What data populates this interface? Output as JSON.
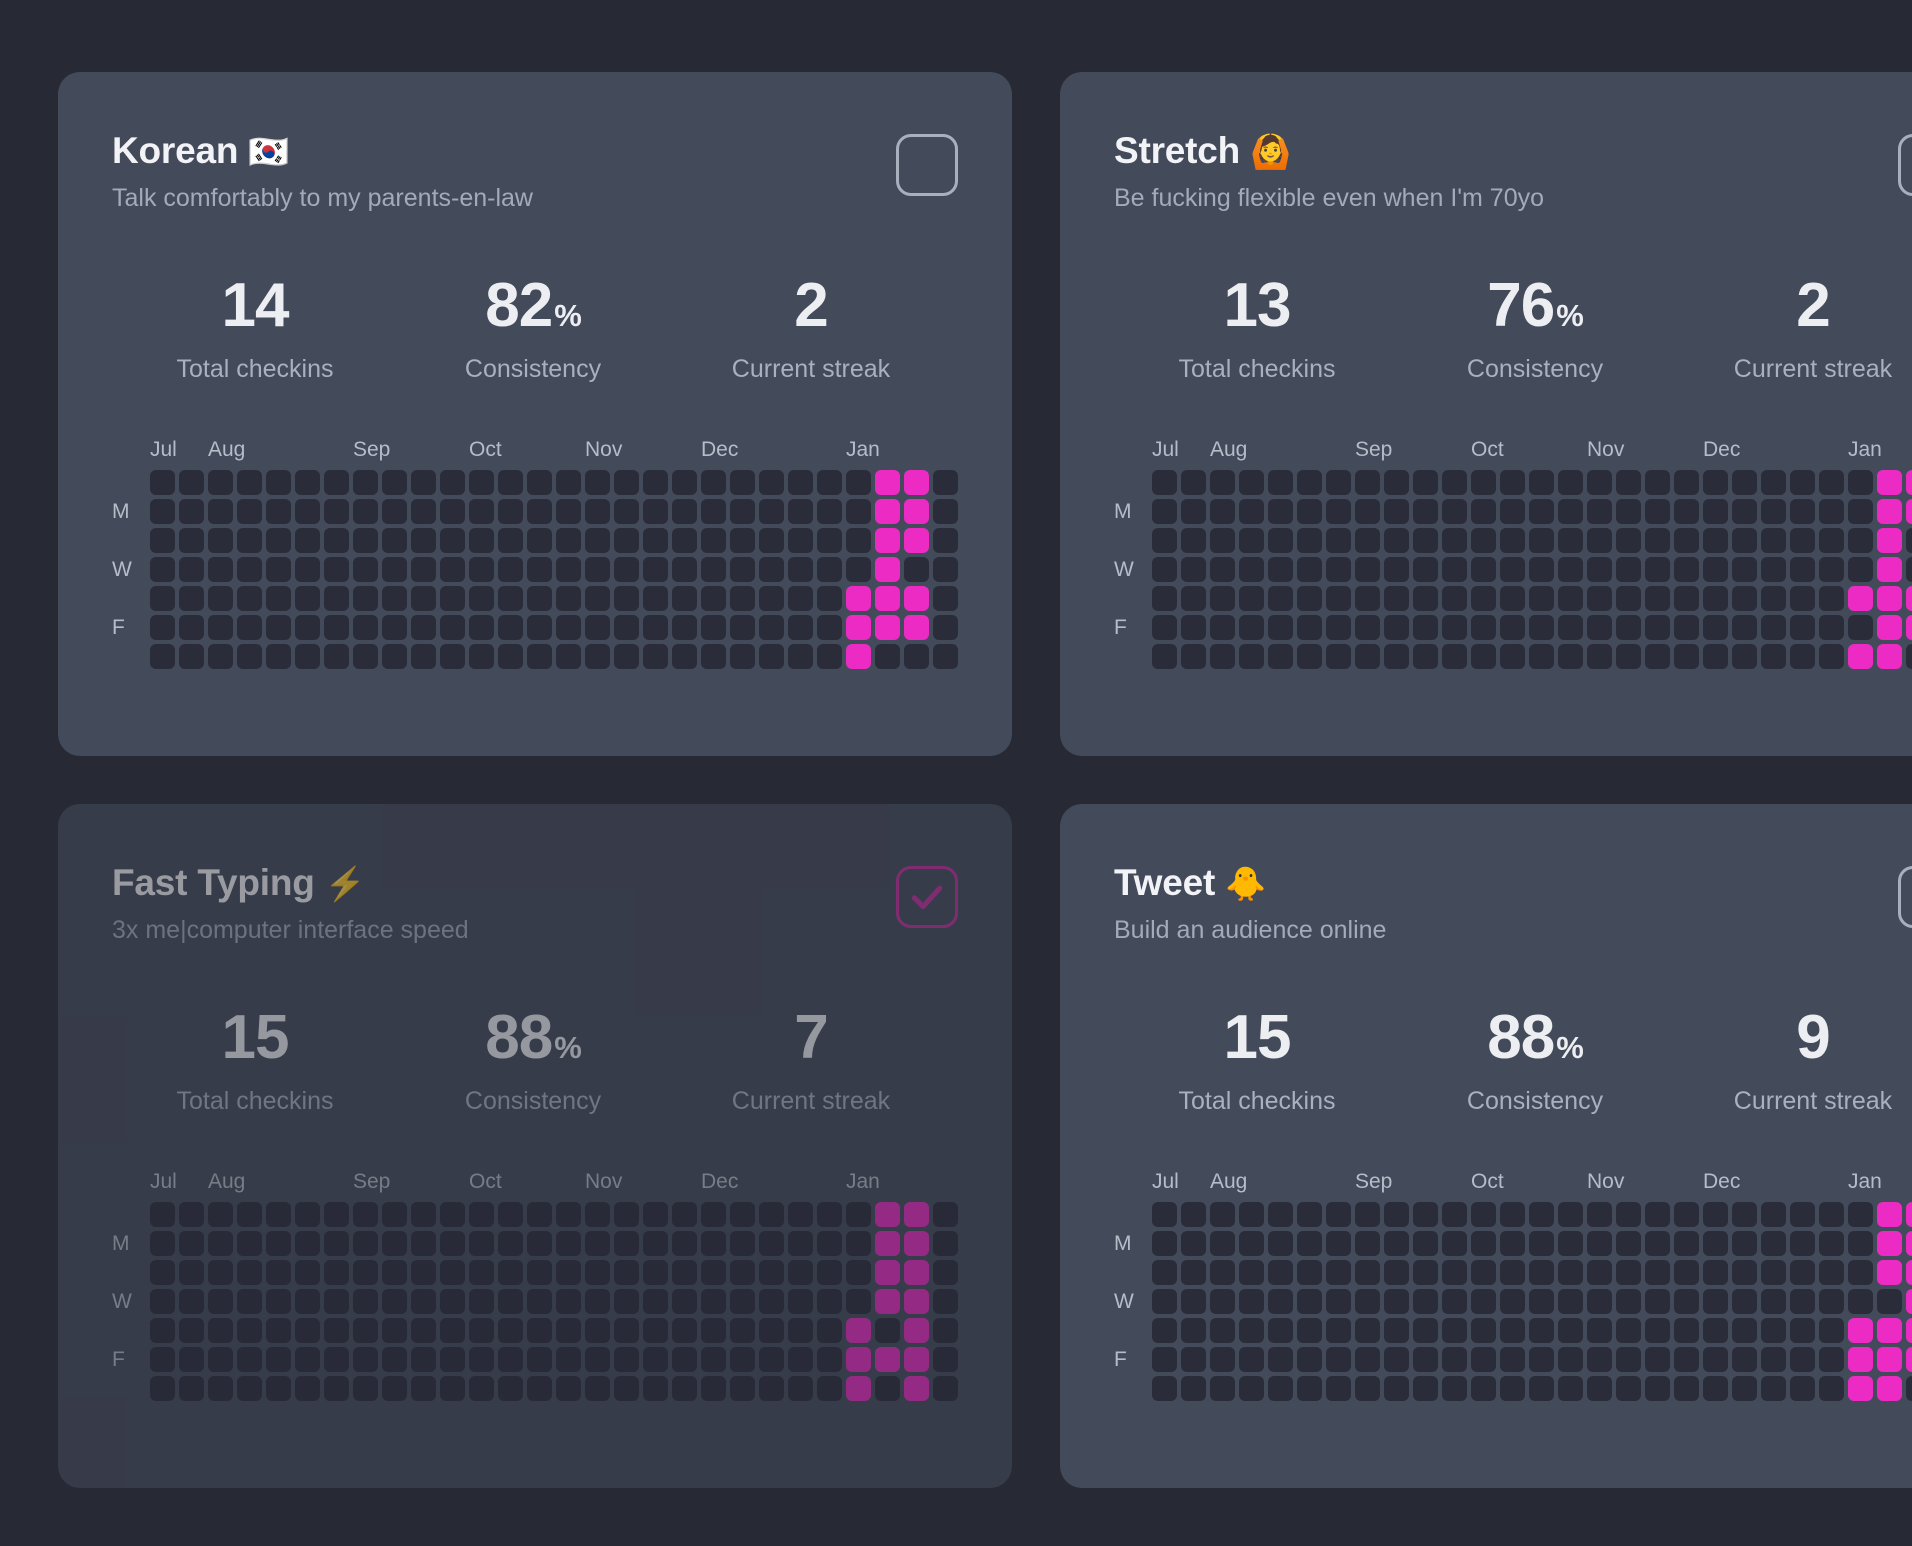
{
  "theme": {
    "background": "#272a35",
    "card_background": "#434a5a",
    "accent": "#ec2bc4",
    "cell_empty": "#2a2d39",
    "text_primary": "#f2f3f6",
    "text_secondary": "#a9b0be"
  },
  "heatmap_meta": {
    "columns": 28,
    "rows": 7,
    "day_labels": [
      "",
      "M",
      "",
      "W",
      "",
      "F",
      ""
    ],
    "months": [
      {
        "label": "Jul",
        "col": 0
      },
      {
        "label": "Aug",
        "col": 2
      },
      {
        "label": "Sep",
        "col": 7
      },
      {
        "label": "Oct",
        "col": 11
      },
      {
        "label": "Nov",
        "col": 15
      },
      {
        "label": "Dec",
        "col": 19
      },
      {
        "label": "Jan",
        "col": 24
      }
    ]
  },
  "stat_labels": {
    "total": "Total checkins",
    "consistency": "Consistency",
    "streak": "Current streak"
  },
  "cards": [
    {
      "id": "korean",
      "title": "Korean",
      "emoji": "🇰🇷",
      "subtitle": "Talk comfortably to my parents-en-law",
      "checked": false,
      "dimmed": false,
      "stats": {
        "total_checkins": "14",
        "consistency": "82",
        "consistency_suffix": "%",
        "current_streak": "2"
      },
      "active_cells": [
        [
          24,
          4
        ],
        [
          24,
          5
        ],
        [
          24,
          6
        ],
        [
          25,
          0
        ],
        [
          25,
          1
        ],
        [
          25,
          2
        ],
        [
          25,
          3
        ],
        [
          25,
          4
        ],
        [
          25,
          5
        ],
        [
          26,
          0
        ],
        [
          26,
          1
        ],
        [
          26,
          2
        ],
        [
          26,
          4
        ],
        [
          26,
          5
        ]
      ]
    },
    {
      "id": "stretch",
      "title": "Stretch",
      "emoji": "🙆",
      "subtitle": "Be fucking flexible even when I'm 70yo",
      "checked": false,
      "dimmed": false,
      "stats": {
        "total_checkins": "13",
        "consistency": "76",
        "consistency_suffix": "%",
        "current_streak": "2"
      },
      "active_cells": [
        [
          24,
          4
        ],
        [
          24,
          6
        ],
        [
          25,
          0
        ],
        [
          25,
          1
        ],
        [
          25,
          2
        ],
        [
          25,
          3
        ],
        [
          25,
          4
        ],
        [
          25,
          5
        ],
        [
          25,
          6
        ],
        [
          26,
          0
        ],
        [
          26,
          1
        ],
        [
          26,
          4
        ],
        [
          26,
          5
        ]
      ]
    },
    {
      "id": "fast-typing",
      "title": "Fast Typing",
      "emoji": "⚡",
      "subtitle": "3x me|computer interface speed",
      "checked": true,
      "dimmed": true,
      "stats": {
        "total_checkins": "15",
        "consistency": "88",
        "consistency_suffix": "%",
        "current_streak": "7"
      },
      "active_cells": [
        [
          24,
          4
        ],
        [
          24,
          5
        ],
        [
          24,
          6
        ],
        [
          25,
          0
        ],
        [
          25,
          1
        ],
        [
          25,
          2
        ],
        [
          25,
          3
        ],
        [
          25,
          5
        ],
        [
          26,
          0
        ],
        [
          26,
          1
        ],
        [
          26,
          2
        ],
        [
          26,
          3
        ],
        [
          26,
          4
        ],
        [
          26,
          5
        ],
        [
          26,
          6
        ]
      ]
    },
    {
      "id": "tweet",
      "title": "Tweet",
      "emoji": "🐥",
      "subtitle": "Build an audience online",
      "checked": false,
      "dimmed": false,
      "stats": {
        "total_checkins": "15",
        "consistency": "88",
        "consistency_suffix": "%",
        "current_streak": "9"
      },
      "active_cells": [
        [
          24,
          4
        ],
        [
          24,
          5
        ],
        [
          24,
          6
        ],
        [
          25,
          0
        ],
        [
          25,
          1
        ],
        [
          25,
          2
        ],
        [
          25,
          4
        ],
        [
          25,
          5
        ],
        [
          25,
          6
        ],
        [
          26,
          0
        ],
        [
          26,
          1
        ],
        [
          26,
          2
        ],
        [
          26,
          3
        ],
        [
          26,
          4
        ],
        [
          26,
          5
        ]
      ]
    }
  ]
}
